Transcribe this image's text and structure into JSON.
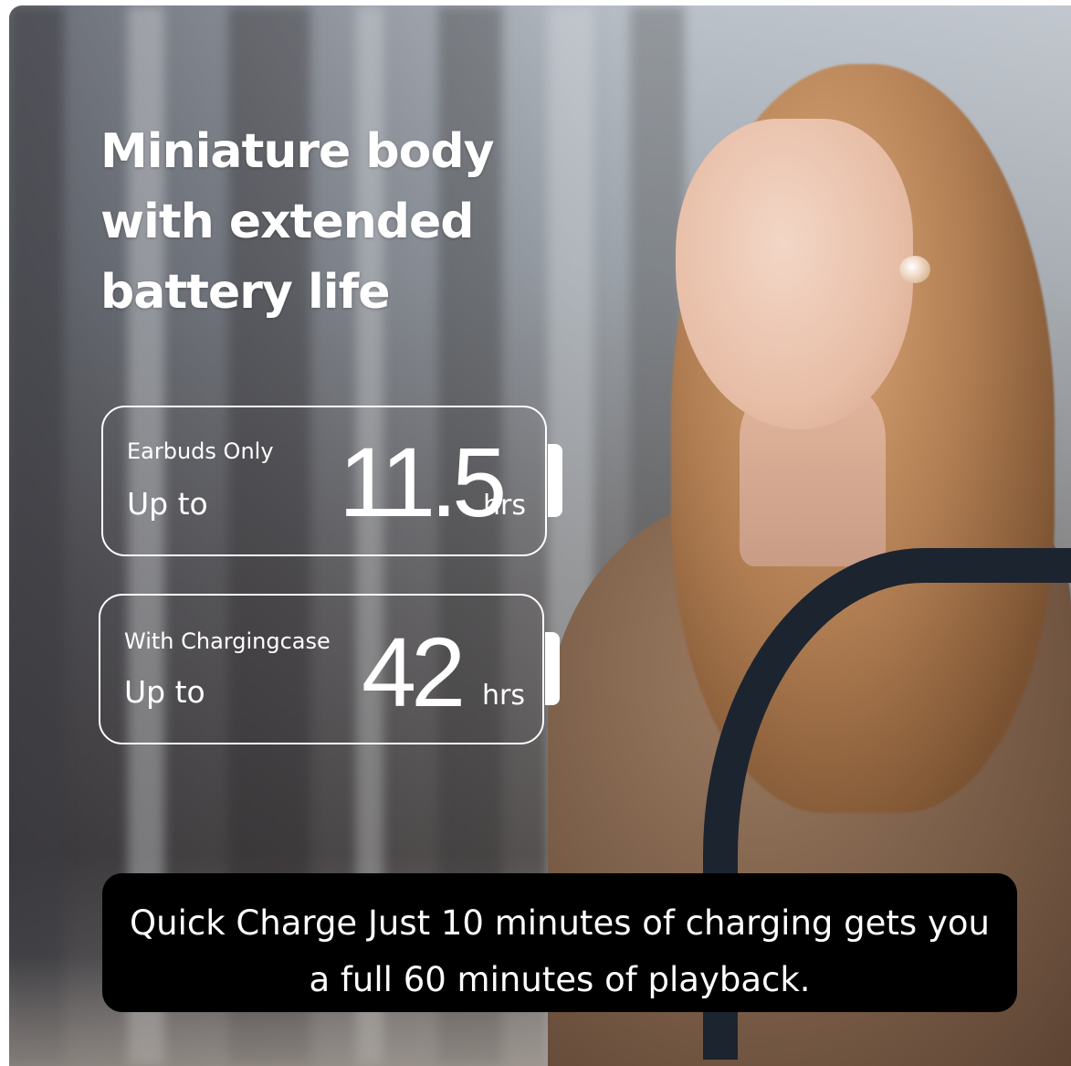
{
  "headline": {
    "lines": [
      "Miniature body",
      "with extended",
      "battery life"
    ]
  },
  "batteries": [
    {
      "label": "Earbuds Only",
      "prefix": "Up to",
      "value": "11.5",
      "unit": "hrs"
    },
    {
      "label": "With Chargingcase",
      "prefix": "Up to",
      "value": "42",
      "unit": "hrs"
    }
  ],
  "banner": {
    "line1": "Quick Charge Just 10 minutes of charging gets you",
    "line2": "a full 60 minutes of playback."
  },
  "colors": {
    "text": "#ffffff",
    "banner_bg": "#000000",
    "card_border": "#ffffff"
  }
}
